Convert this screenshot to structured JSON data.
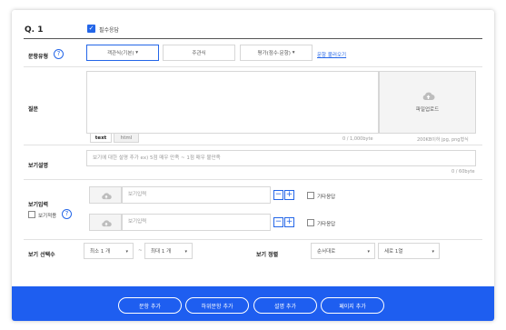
{
  "header": {
    "question_no": "Q. 1",
    "required_label": "필수응답"
  },
  "type_row": {
    "label": "문항유형",
    "help": "?",
    "options": [
      "객관식(기본)",
      "주관식",
      "평가(점수·문항)"
    ],
    "selected_index": 0,
    "link": "문항 불러오기"
  },
  "question": {
    "label": "질문",
    "upload_label": "파일업로드",
    "tabs": [
      "text",
      "html"
    ],
    "char_count": "0 / 1,000byte",
    "file_hint": "200KB이하 jpg, png형식"
  },
  "description": {
    "label": "보기설명",
    "placeholder": "보기에 대한 설명 추가 ex) 5점 매우 만족 ~ 1점 매우 불만족",
    "char_count": "0 / 60byte"
  },
  "options_input": {
    "label": "보기입력",
    "apply_label": "보기적용",
    "help": "?",
    "rows": [
      {
        "placeholder": "보기입력",
        "other_label": "기타응답"
      },
      {
        "placeholder": "보기입력",
        "other_label": "기타응답"
      }
    ]
  },
  "count_row": {
    "label": "보기 선택수",
    "min_value": "최소 1 개",
    "separator": "~",
    "max_value": "최대 1 개",
    "sort_label": "보기 정렬",
    "sort_value": "순서대로",
    "layout_value": "세로 1열"
  },
  "footer": {
    "buttons": [
      "문항 추가",
      "하위문항 추가",
      "설명 추가",
      "페이지 추가"
    ]
  },
  "colors": {
    "accent": "#2466e8",
    "footer_bg": "#1e5ef0"
  }
}
